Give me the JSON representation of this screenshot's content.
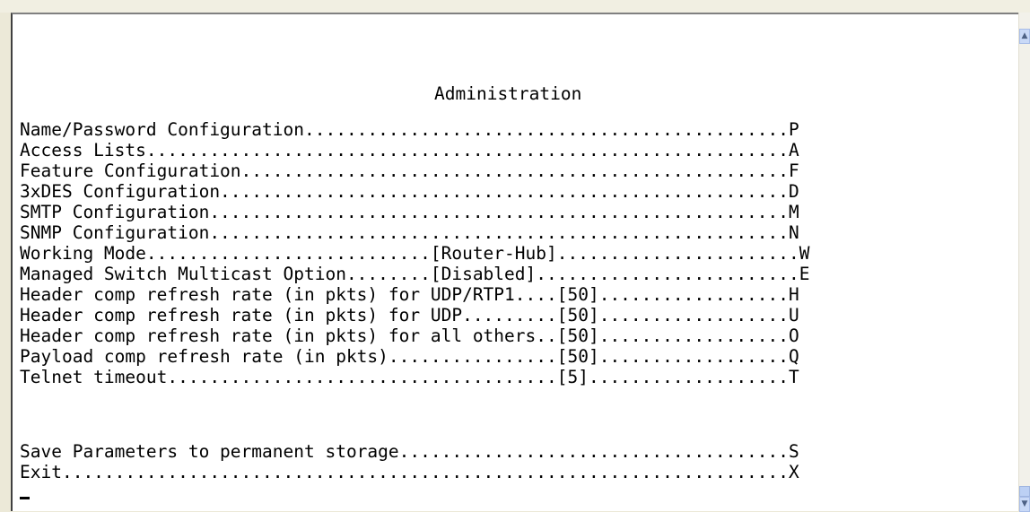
{
  "screen": {
    "title": "Administration",
    "menu": [
      {
        "text": "Name/Password Configuration..............................................P"
      },
      {
        "text": "Access Lists.............................................................A"
      },
      {
        "text": "Feature Configuration....................................................F"
      },
      {
        "text": "3xDES Configuration......................................................D"
      },
      {
        "text": "SMTP Configuration.......................................................M"
      },
      {
        "text": "SNMP Configuration.......................................................N"
      },
      {
        "text": "Working Mode...........................[Router-Hub].......................W"
      },
      {
        "text": "Managed Switch Multicast Option........[Disabled].........................E"
      },
      {
        "text": "Header comp refresh rate (in pkts) for UDP/RTP1....[50]..................H"
      },
      {
        "text": "Header comp refresh rate (in pkts) for UDP.........[50]..................U"
      },
      {
        "text": "Header comp refresh rate (in pkts) for all others..[50]..................O"
      },
      {
        "text": "Payload comp refresh rate (in pkts)................[50]..................Q"
      },
      {
        "text": "Telnet timeout.....................................[5]...................T"
      }
    ],
    "footer_menu": [
      {
        "text": "Save Parameters to permanent storage.....................................S"
      },
      {
        "text": "Exit.....................................................................X"
      }
    ]
  },
  "icons": {
    "scroll_up": "triangle-up-icon",
    "scroll_down": "triangle-down-icon"
  }
}
